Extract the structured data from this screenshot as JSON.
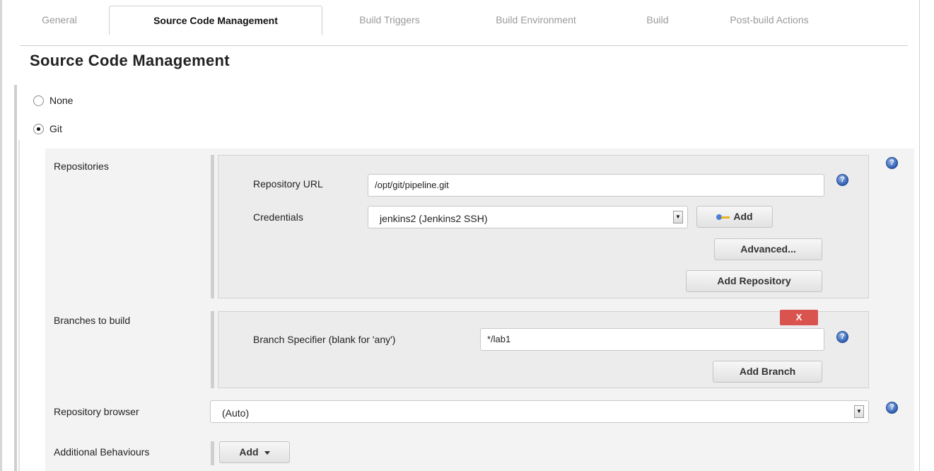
{
  "tabs": [
    {
      "label": "General",
      "active": false
    },
    {
      "label": "Source Code Management",
      "active": true
    },
    {
      "label": "Build Triggers",
      "active": false
    },
    {
      "label": "Build Environment",
      "active": false
    },
    {
      "label": "Build",
      "active": false
    },
    {
      "label": "Post-build Actions",
      "active": false
    }
  ],
  "section_title": "Source Code Management",
  "scm_options": [
    {
      "label": "None",
      "selected": false
    },
    {
      "label": "Git",
      "selected": true
    }
  ],
  "repositories": {
    "label": "Repositories",
    "url_label": "Repository URL",
    "url_value": "/opt/git/pipeline.git",
    "credentials_label": "Credentials",
    "credentials_value": "jenkins2 (Jenkins2 SSH)",
    "add_label": "Add",
    "advanced_label": "Advanced...",
    "add_repository_label": "Add Repository"
  },
  "branches": {
    "label": "Branches to build",
    "delete_label": "X",
    "specifier_label": "Branch Specifier (blank for 'any')",
    "specifier_value": "*/lab1",
    "add_branch_label": "Add Branch"
  },
  "repo_browser": {
    "label": "Repository browser",
    "value": "(Auto)"
  },
  "additional_behaviours": {
    "label": "Additional Behaviours",
    "add_label": "Add"
  },
  "icons": {
    "help": "help-icon",
    "key": "key-icon",
    "dropdown": "chevron-down-icon"
  },
  "colors": {
    "delete_button": "#d9534f",
    "help_icon": "#2f5fb3"
  }
}
